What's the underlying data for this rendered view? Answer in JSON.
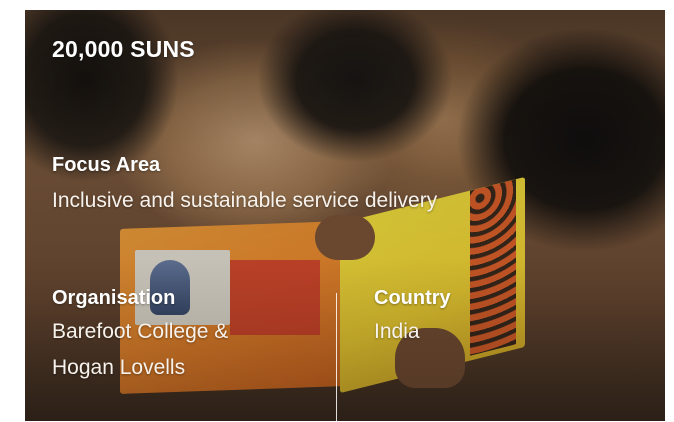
{
  "card": {
    "title": "20,000 SUNS",
    "focus_area": {
      "label": "Focus Area",
      "value": "Inclusive and sustainable service delivery"
    },
    "organisation": {
      "label": "Organisation",
      "value_line1": "Barefoot College &",
      "value_line2": "Hogan Lovells"
    },
    "country": {
      "label": "Country",
      "value": "India"
    }
  },
  "colors": {
    "text": "#ffffff",
    "divider": "#ffffff"
  },
  "background_photo": "children-reading-book-photo"
}
